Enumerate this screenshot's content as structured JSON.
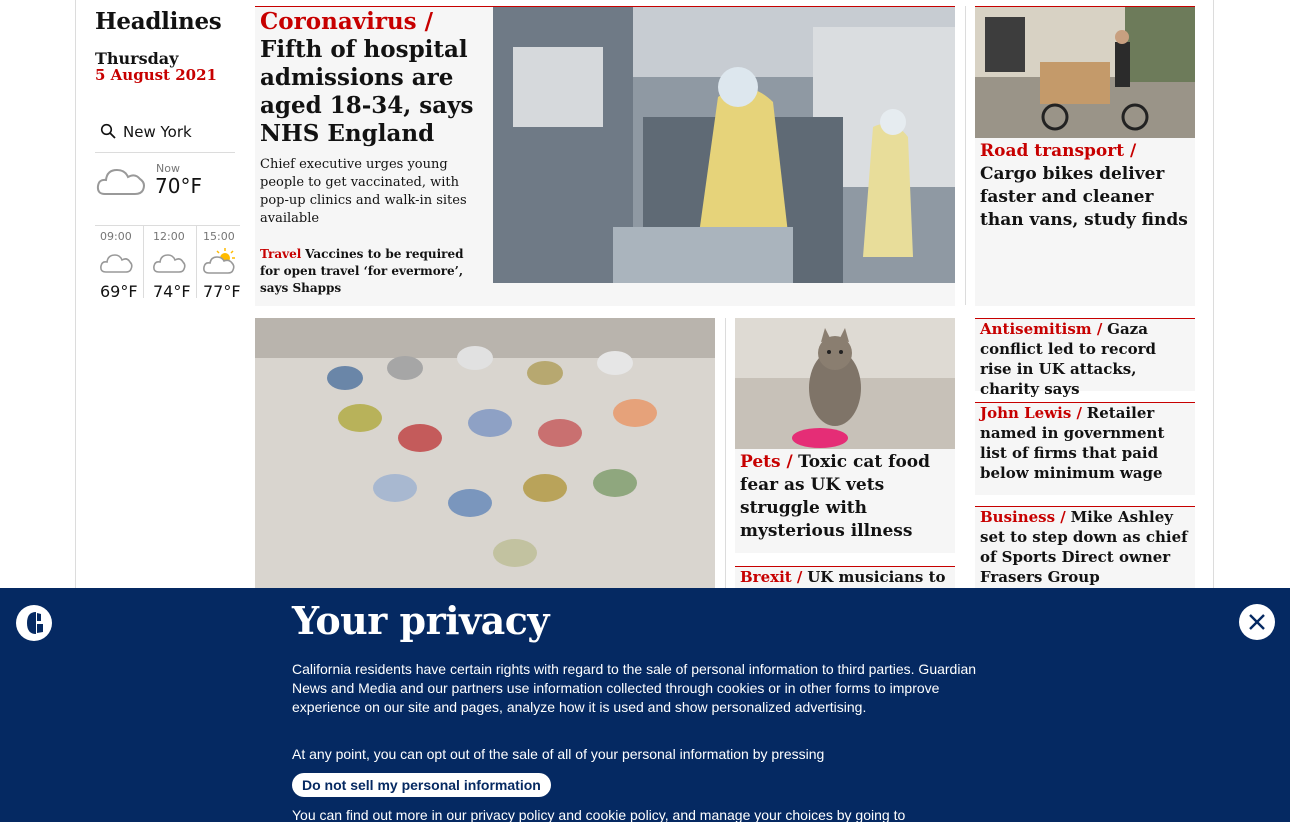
{
  "sidebar": {
    "title": "Headlines",
    "day": "Thursday",
    "date": "5 August 2021",
    "location": "New York",
    "now_label": "Now",
    "now_temp": "70°F",
    "forecast": [
      {
        "time": "09:00",
        "temp": "69°F",
        "icon": "cloud-icon"
      },
      {
        "time": "12:00",
        "temp": "74°F",
        "icon": "cloud-icon"
      },
      {
        "time": "15:00",
        "temp": "77°F",
        "icon": "partly-sunny-icon"
      }
    ]
  },
  "main_story": {
    "kicker": "Coronavirus /",
    "headline": "Fifth of hospital admissions are aged 18-34, says NHS England",
    "standfirst": "Chief executive urges young people to get vaccinated, with pop-up clinics and walk-in sites available",
    "sublink_kicker": "Travel",
    "sublink_text": "Vaccines to be required for open travel ‘for evermore’, says Shapps"
  },
  "stories": {
    "road": {
      "kicker": "Road transport /",
      "headline": "Cargo bikes deliver faster and cleaner than vans, study finds"
    },
    "antisemitism": {
      "kicker": "Antisemitism /",
      "headline": "Gaza conflict led to record rise in UK attacks, charity says"
    },
    "johnlewis": {
      "kicker": "John Lewis /",
      "headline": "Retailer named in government list of firms that paid below minimum wage"
    },
    "business": {
      "kicker": "Business /",
      "headline": "Mike Ashley set to step down as chief of Sports Direct owner Frasers Group"
    },
    "pets": {
      "kicker": "Pets /",
      "headline": "Toxic cat food fear as UK vets struggle with mysterious illness"
    },
    "brexit": {
      "kicker": "Brexit /",
      "headline": "UK musicians to"
    }
  },
  "privacy": {
    "title": "Your privacy",
    "text": "California residents have certain rights with regard to the sale of personal information to third parties. Guardian News and Media and our partners use information collected through cookies or in other forms to improve experience on our site and pages, analyze how it is used and show personalized advertising.",
    "text2": "At any point, you can opt out of the sale of all of your personal information by pressing",
    "button": "Do not sell my personal information",
    "text3": "You can find out more in our privacy policy and cookie policy, and manage your choices by going to"
  },
  "colors": {
    "brand_red": "#c70000",
    "banner_blue": "#052962"
  }
}
